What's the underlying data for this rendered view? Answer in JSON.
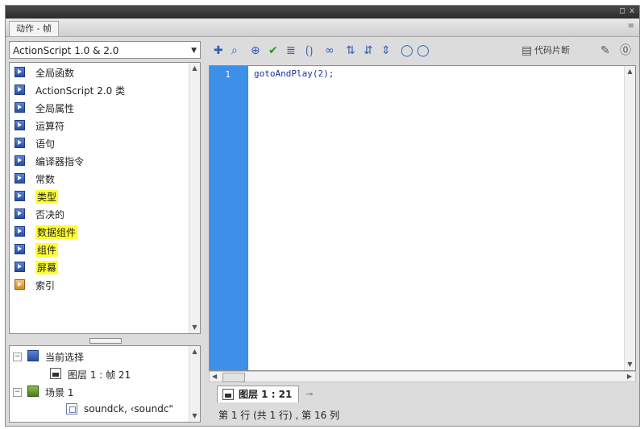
{
  "window": {
    "panel_tab": "动作 - 帧",
    "window_controls": "□ x",
    "panel_menu_icon": "≡"
  },
  "left_panel": {
    "version_select": "ActionScript 1.0 & 2.0",
    "book_items": [
      {
        "label": "全局函数",
        "highlighted": false,
        "icon": "book-icon"
      },
      {
        "label": "ActionScript 2.0 类",
        "highlighted": false,
        "icon": "book-icon"
      },
      {
        "label": "全局属性",
        "highlighted": false,
        "icon": "book-icon"
      },
      {
        "label": "运算符",
        "highlighted": false,
        "icon": "book-icon"
      },
      {
        "label": "语句",
        "highlighted": false,
        "icon": "book-icon"
      },
      {
        "label": "编译器指令",
        "highlighted": false,
        "icon": "book-icon"
      },
      {
        "label": "常数",
        "highlighted": false,
        "icon": "book-icon"
      },
      {
        "label": "类型",
        "highlighted": true,
        "icon": "book-icon"
      },
      {
        "label": "否决的",
        "highlighted": false,
        "icon": "book-icon"
      },
      {
        "label": "数据组件",
        "highlighted": true,
        "icon": "book-icon"
      },
      {
        "label": "组件",
        "highlighted": true,
        "icon": "book-icon"
      },
      {
        "label": "屏幕",
        "highlighted": true,
        "icon": "book-icon"
      },
      {
        "label": "索引",
        "highlighted": false,
        "icon": "index-icon"
      }
    ],
    "script_tree": {
      "current_selection": "当前选择",
      "current_frame": "图层 1 : 帧 21",
      "scene": "场景 1",
      "sound_item": "soundck, ‹soundc\""
    }
  },
  "editor": {
    "toolbar": {
      "code_snippets_label": "代码片断",
      "icons": [
        "add-item-icon",
        "find-icon",
        "target-icon",
        "check-syntax-icon",
        "auto-format-icon",
        "code-hint-icon",
        "debug-icon",
        "collapse-icon",
        "collapse-selection-icon",
        "expand-all-icon",
        "comment-icon",
        "uncomment-icon",
        "code-snippets-icon",
        "script-assist-icon",
        "help-icon"
      ]
    },
    "line_number": "1",
    "code": "gotoAndPlay(2);",
    "script_tab": "图层 1 : 21",
    "status": "第 1 行 (共 1 行) , 第 16 列"
  }
}
